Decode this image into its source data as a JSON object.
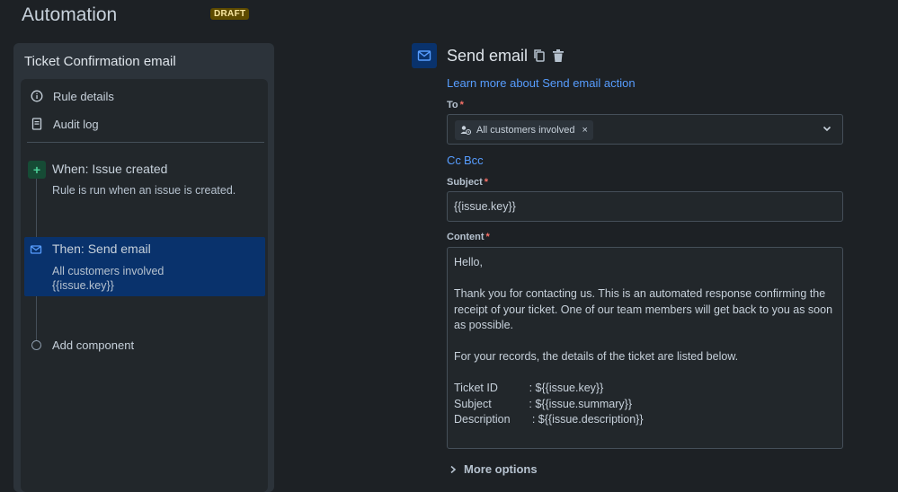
{
  "header": {
    "title": "Automation",
    "badge": "DRAFT"
  },
  "rule": {
    "name": "Ticket Confirmation email",
    "menu": [
      {
        "label": "Rule details",
        "icon": "info-icon"
      },
      {
        "label": "Audit log",
        "icon": "document-icon"
      }
    ],
    "trigger": {
      "title": "When: Issue created",
      "subtitle": "Rule is run when an issue is created."
    },
    "action": {
      "title": "Then: Send email",
      "line1": "All customers involved",
      "line2": "{{issue.key}}"
    },
    "add_component": "Add component"
  },
  "email": {
    "title": "Send email",
    "learn_more": "Learn more about Send email action",
    "to_label": "To",
    "recipient_chip": "All customers involved",
    "cc": "Cc",
    "bcc": "Bcc",
    "subject_label": "Subject",
    "subject_value": "{{issue.key}}",
    "content_label": "Content",
    "content_value": "Hello,\n\nThank you for contacting us. This is an automated response confirming the receipt of your ticket. One of our team members will get back to you as soon as possible.\n\nFor your records, the details of the ticket are listed below.\n\nTicket ID          : ${{issue.key}}\nSubject            : ${{issue.summary}}\nDescription       : ${{issue.description}}",
    "more_options": "More options",
    "required_mark": "*"
  },
  "colors": {
    "accent": "#579dff",
    "selected_bg": "#09326c",
    "required": "#f87168",
    "badge_bg": "#5e4b00"
  }
}
